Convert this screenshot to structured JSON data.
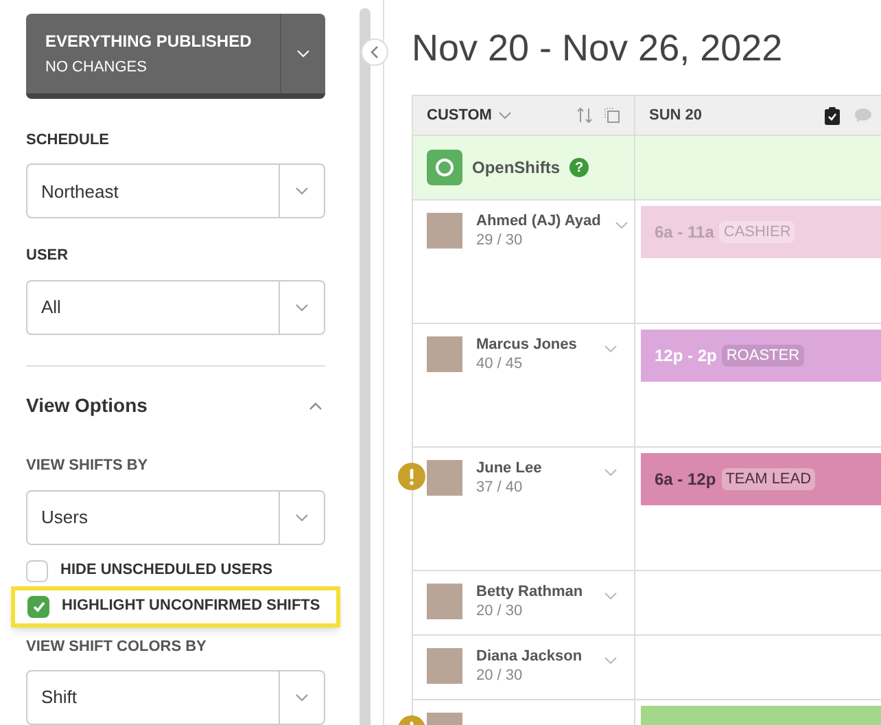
{
  "publish": {
    "title": "EVERYTHING PUBLISHED",
    "subtitle": "NO CHANGES"
  },
  "filters": [
    {
      "label": "SCHEDULE",
      "value": "Northeast"
    },
    {
      "label": "USER",
      "value": "All"
    }
  ],
  "view_options": {
    "title": "View Options",
    "expanded": true,
    "shifts_by": {
      "label": "VIEW SHIFTS BY",
      "value": "Users"
    },
    "checkboxes": [
      {
        "label": "HIDE UNSCHEDULED USERS",
        "checked": false,
        "highlighted": false
      },
      {
        "label": "HIGHLIGHT UNCONFIRMED SHIFTS",
        "checked": true,
        "highlighted": true
      }
    ],
    "colors_by": {
      "label": "VIEW SHIFT COLORS BY",
      "value": "Shift"
    }
  },
  "date_range": "Nov 20 - Nov 26, 2022",
  "table": {
    "sort_label": "CUSTOM",
    "day": "SUN 20",
    "open_shifts": {
      "label": "OpenShifts",
      "help": "?"
    },
    "rows": [
      {
        "name": "Ahmed (AJ) Ayad",
        "hours": "29 / 30",
        "warning": false,
        "tall": true,
        "shift": {
          "time": "6a - 11a",
          "role": "CASHIER",
          "color": "#f0cfe0",
          "kind": "unconfirmed"
        }
      },
      {
        "name": "Marcus Jones",
        "hours": "40 / 45",
        "warning": false,
        "tall": true,
        "shift": {
          "time": "12p - 2p",
          "role": "ROASTER",
          "color": "#dca8dc",
          "kind": "inverse"
        }
      },
      {
        "name": "June Lee",
        "hours": "37 / 40",
        "warning": true,
        "tall": true,
        "shift": {
          "time": "6a - 12p",
          "role": "TEAM LEAD",
          "color": "#d98aae",
          "kind": "standard"
        }
      },
      {
        "name": "Betty Rathman",
        "hours": "20 / 30",
        "warning": false,
        "tall": false
      },
      {
        "name": "Diana Jackson",
        "hours": "20 / 30",
        "warning": false,
        "tall": false
      },
      {
        "warning": true,
        "tall": false,
        "shift": {
          "color": "#a3d88a",
          "kind": "standard"
        }
      }
    ]
  }
}
